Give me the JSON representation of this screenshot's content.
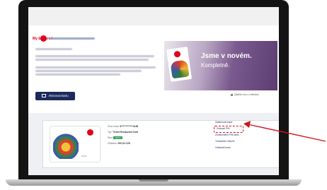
{
  "email": {
    "brand": "My Edenred",
    "greeting_label": "Dobrý den",
    "cta_label": "Aktivovat kartu",
    "banner": {
      "headline": "Jsme v novém.",
      "subline": "Kompletně."
    },
    "see_more_label": "Zjistěte více o změnách"
  },
  "card_panel": {
    "details": {
      "card_number_label": "Číslo karty:",
      "card_number_value": "6*************4148",
      "type_label": "Typ:",
      "type_value": "Ticket Restaurant Card",
      "status_label": "Stav:",
      "status_value": "Aktivní",
      "balance_label": "Zůstatek:",
      "balance_value": "000,00 CZK"
    },
    "card_art_number": "06/28",
    "actions": [
      "Zablokovat kartu",
      "Zobrazit PIN",
      "Zrušit/změnit PIN kartu",
      "Transakční historie",
      "Odstranit kartu"
    ],
    "highlighted_action_index": 1
  },
  "colors": {
    "brand_red": "#e2001a",
    "navy": "#1c2a5c",
    "annotation_red": "#d0141a",
    "status_green": "#2e9d57"
  }
}
